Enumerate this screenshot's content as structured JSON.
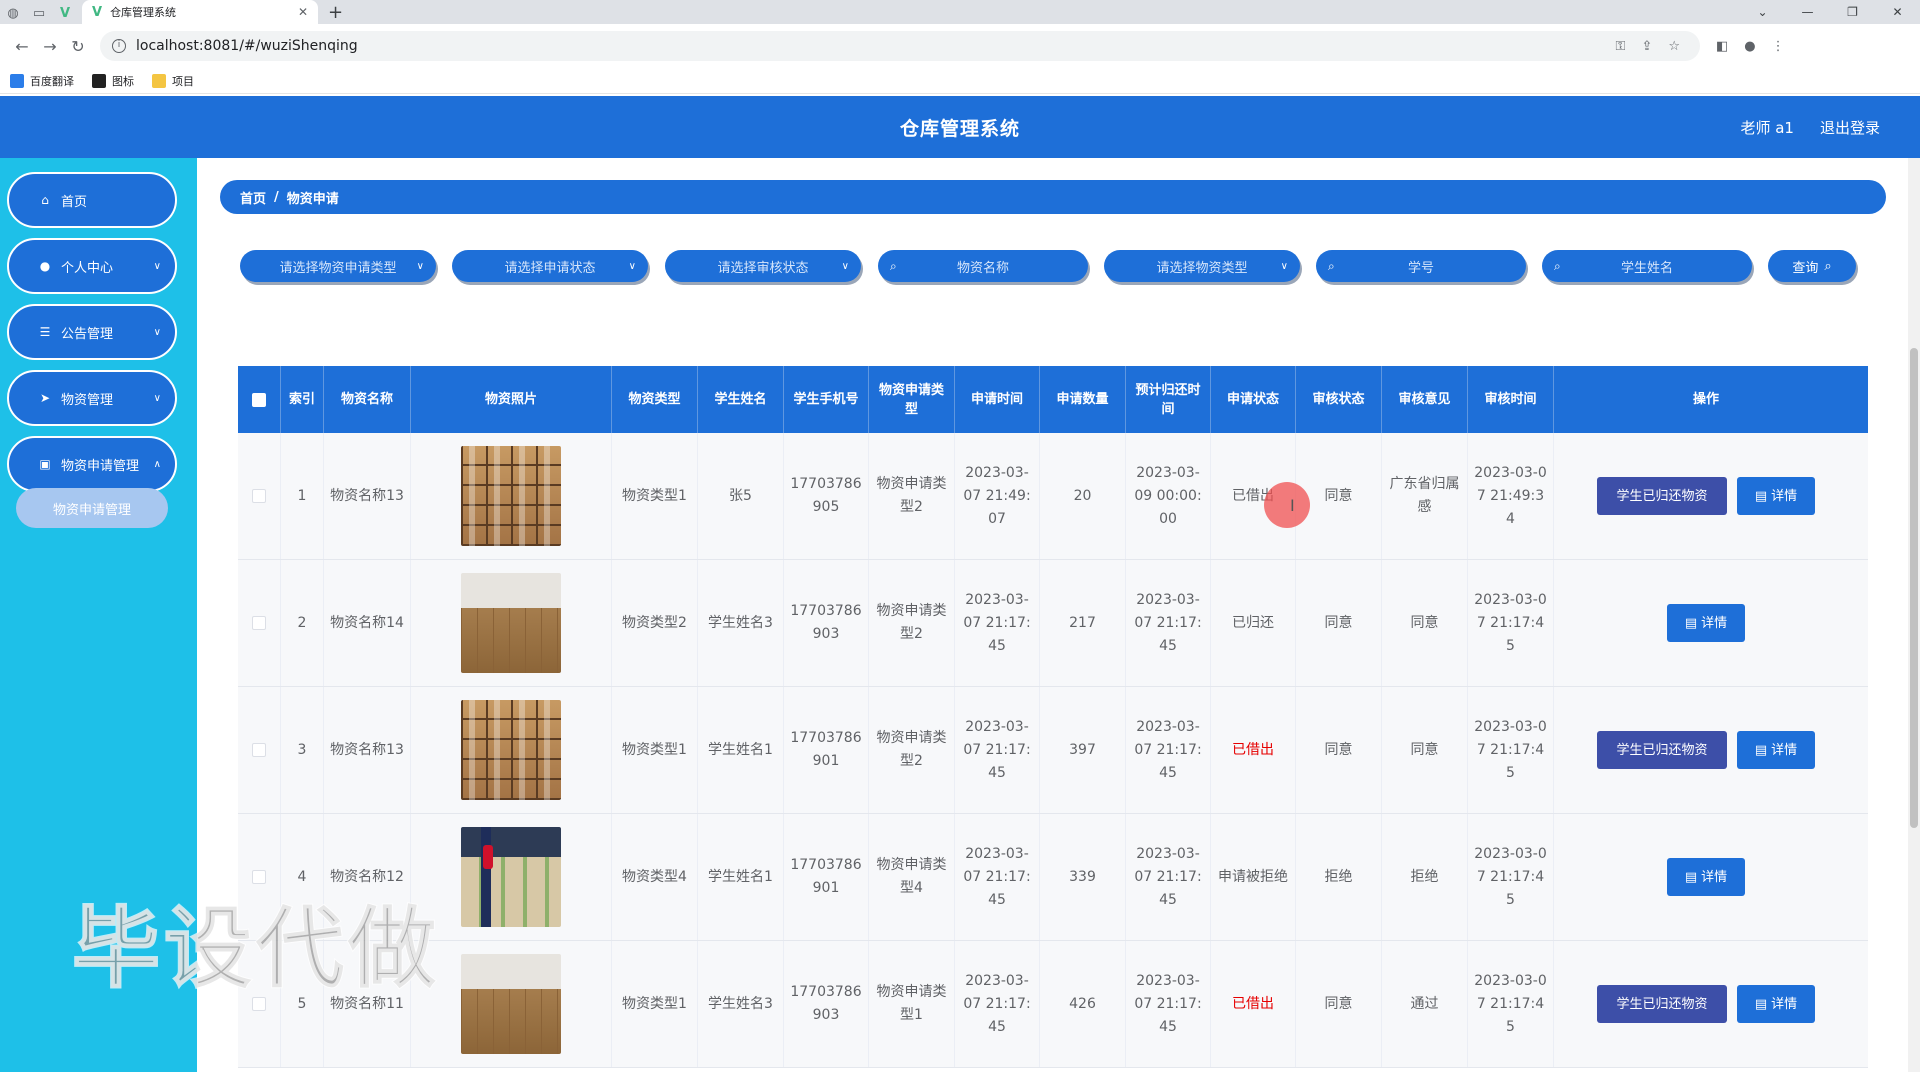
{
  "browser": {
    "tab_title": "仓库管理系统",
    "url": "localhost:8081/#/wuziShenqing",
    "bookmarks": [
      "百度翻译",
      "图标",
      "项目"
    ]
  },
  "header": {
    "title": "仓库管理系统",
    "user": "老师 a1",
    "logout": "退出登录"
  },
  "sidebar": {
    "items": [
      {
        "label": "首页",
        "icon": "home-icon"
      },
      {
        "label": "个人中心",
        "icon": "user-icon"
      },
      {
        "label": "公告管理",
        "icon": "sliders-icon"
      },
      {
        "label": "物资管理",
        "icon": "send-icon"
      },
      {
        "label": "物资申请管理",
        "icon": "doc-icon"
      }
    ],
    "submenu": "物资申请管理"
  },
  "breadcrumb": {
    "home": "首页",
    "current": "物资申请"
  },
  "filters": {
    "apply_type": "请选择物资申请类型",
    "apply_status": "请选择申请状态",
    "review_status": "请选择审核状态",
    "name_placeholder": "物资名称",
    "goods_type": "请选择物资类型",
    "student_no": "学号",
    "student_name": "学生姓名",
    "query": "查询"
  },
  "table": {
    "headers": [
      "索引",
      "物资名称",
      "物资照片",
      "物资类型",
      "学生姓名",
      "学生手机号",
      "物资申请类型",
      "申请时间",
      "申请数量",
      "预计归还时间",
      "申请状态",
      "审核状态",
      "审核意见",
      "审核时间",
      "操作"
    ],
    "return_label": "学生已归还物资",
    "detail_label": "详情",
    "rows": [
      {
        "index": "1",
        "name": "物资名称13",
        "type": "物资类型1",
        "student": "张5",
        "phone": "17703786905",
        "apply_type": "物资申请类型2",
        "apply_time": "2023-03-07 21:49:07",
        "qty": "20",
        "return_time": "2023-03-09 00:00:00",
        "status": "已借出",
        "review": "同意",
        "opinion": "广东省归属感",
        "review_time": "2023-03-07 21:49:34"
      },
      {
        "index": "2",
        "name": "物资名称14",
        "type": "物资类型2",
        "student": "学生姓名3",
        "phone": "17703786903",
        "apply_type": "物资申请类型2",
        "apply_time": "2023-03-07 21:17:45",
        "qty": "217",
        "return_time": "2023-03-07 21:17:45",
        "status": "已归还",
        "review": "同意",
        "opinion": "同意",
        "review_time": "2023-03-07 21:17:45"
      },
      {
        "index": "3",
        "name": "物资名称13",
        "type": "物资类型1",
        "student": "学生姓名1",
        "phone": "17703786901",
        "apply_type": "物资申请类型2",
        "apply_time": "2023-03-07 21:17:45",
        "qty": "397",
        "return_time": "2023-03-07 21:17:45",
        "status": "已借出",
        "review": "同意",
        "opinion": "同意",
        "review_time": "2023-03-07 21:17:45"
      },
      {
        "index": "4",
        "name": "物资名称12",
        "type": "物资类型4",
        "student": "学生姓名1",
        "phone": "17703786901",
        "apply_type": "物资申请类型4",
        "apply_time": "2023-03-07 21:17:45",
        "qty": "339",
        "return_time": "2023-03-07 21:17:45",
        "status": "申请被拒绝",
        "review": "拒绝",
        "opinion": "拒绝",
        "review_time": "2023-03-07 21:17:45"
      },
      {
        "index": "5",
        "name": "物资名称11",
        "type": "物资类型1",
        "student": "学生姓名3",
        "phone": "17703786903",
        "apply_type": "物资申请类型1",
        "apply_time": "2023-03-07 21:17:45",
        "qty": "426",
        "return_time": "2023-03-07 21:17:45",
        "status": "已借出",
        "review": "同意",
        "opinion": "通过",
        "review_time": "2023-03-07 21:17:45"
      }
    ]
  },
  "watermark": "毕设代做",
  "colors": {
    "header": "#1e6fd8",
    "sidebar": "#1ec0e8",
    "return_button": "#3d4fa8",
    "status_red": "#e60000"
  }
}
